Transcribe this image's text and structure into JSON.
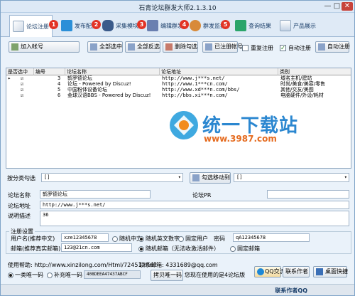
{
  "window": {
    "title": "石青论坛群发大师2.1.3.10",
    "min": "—",
    "max": "□",
    "close": "✕"
  },
  "tabs": [
    {
      "label": "论坛注册",
      "badge": "1",
      "color": "#3b6fb6"
    },
    {
      "label": "发布配置",
      "badge": "2",
      "color": "#2b8fd8"
    },
    {
      "label": "采集模块",
      "badge": "3",
      "color": "#3a5a8a"
    },
    {
      "label": "编辑群发",
      "badge": "4",
      "color": "#6a7fb0"
    },
    {
      "label": "群发监控",
      "badge": "5",
      "color": "#d88a3a"
    },
    {
      "label": "查询结果",
      "badge": "",
      "color": "#2aa56a"
    },
    {
      "label": "产品展示",
      "badge": "",
      "color": "#8aa2c8"
    }
  ],
  "toolbar": {
    "add_account": "加入帐号",
    "select_all": "全部选中",
    "invert_all": "全部反选",
    "delete_checked": "删除勾选",
    "registered_accounts": "已注册帐号",
    "reregister": "重复注册",
    "auto_register": "自动注册",
    "auto_register_btn": "自动注册"
  },
  "grid": {
    "headers": [
      "是否选中",
      "编号",
      "论坛名称",
      "论坛地址",
      "类别"
    ],
    "rows": [
      {
        "checked": true,
        "num": "3",
        "name": "鹤罗德论坛",
        "url": "http://www.j***s.net/",
        "cat": "域名主机/建站"
      },
      {
        "checked": true,
        "num": "4",
        "name": "论坛 - Powered by Discuz!",
        "url": "http://www.1***cn.com/",
        "cat": "时尚/美食/美容/零售"
      },
      {
        "checked": true,
        "num": "5",
        "name": "中国粉体设备论坛",
        "url": "http://www.xd***n.com/bbs/",
        "cat": "其他/交友/美图"
      },
      {
        "checked": true,
        "num": "6",
        "name": "金球汉语BBS - Powered by Discuz!",
        "url": "http://bbs.xi***n.com/",
        "cat": "电脑硬件/外设/耗材"
      }
    ]
  },
  "watermark": {
    "big": "统一下载站",
    "url": "www.3987.com"
  },
  "move": {
    "label": "按分类勾选",
    "select_value": "[]",
    "btn": "勾选移动到",
    "target_value": "[]"
  },
  "detail": {
    "name_label": "论坛名称",
    "name_value": "鹤罗德论坛",
    "pr_label": "论坛PR",
    "pr_value": "",
    "url_label": "论坛地址",
    "url_value": "http://www.j***s.net/",
    "desc_label": "说明描述",
    "desc_value": "36"
  },
  "reg": {
    "section": "注册设置",
    "user_label": "用户名(推荐中文)",
    "user_value": "xze12345678",
    "random_cn": "随机中文",
    "random_en": "随机英文数字",
    "fixed_user": "固定用户",
    "pwd_label": "密码",
    "pwd_value": "qA12345678",
    "mail_label": "邮箱(推荐真实邮箱)",
    "mail_value": "123@21cn.com",
    "random_mail": "随机邮箱（无法收激活邮件）",
    "fixed_mail": "固定邮箱"
  },
  "footer": {
    "help": "使用帮助: http://www.xinzilong.com/Html/72451.html",
    "contact": "联系邮箱: 4331689@qq.com",
    "one_machine": "一类唯一码",
    "supplement": "补充唯一码",
    "code": "408DEEA47437ABCF",
    "copy_code": "拷贝唯一码",
    "machine_note": "您现在使用的是4论坛版",
    "qq": "QQ交流",
    "contact_author": "联系作者",
    "desktop": "桌面快捷",
    "status": "联系作者QQ"
  },
  "colors": {
    "accent": "#3b6fb6",
    "badge": "#e23325",
    "grid_select": "#1a1a8a"
  }
}
